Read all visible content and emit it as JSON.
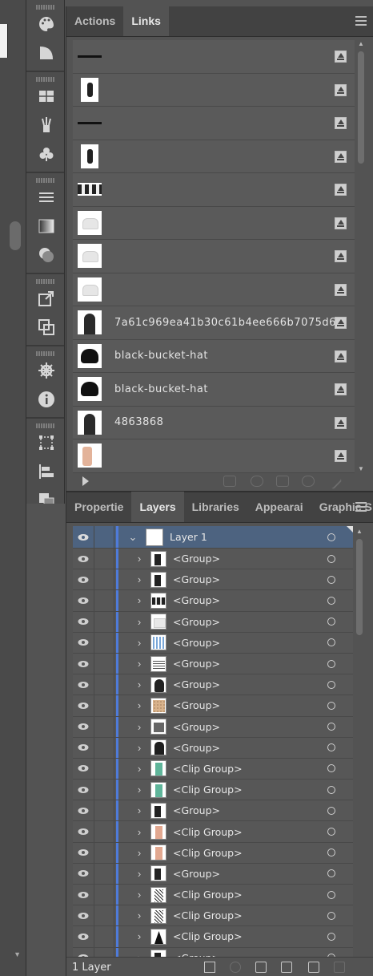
{
  "tools": [
    [
      "palette-icon",
      "gradient-swatch-icon"
    ],
    [
      "swatches-icon",
      "brush-icon",
      "club-icon"
    ],
    [
      "stroke-icon",
      "gradient-icon",
      "transparency-icon"
    ],
    [
      "export-icon",
      "artboards-icon"
    ],
    [
      "helm-icon",
      "info-icon"
    ],
    [
      "transform-icon",
      "align-icon",
      "pathfinder-icon"
    ]
  ],
  "links_panel": {
    "tabs": [
      {
        "label": "Actions",
        "active": false
      },
      {
        "label": "Links",
        "active": true
      }
    ],
    "rows": [
      {
        "thumb": "strip",
        "name": ""
      },
      {
        "thumb": "tall",
        "name": ""
      },
      {
        "thumb": "strip",
        "name": ""
      },
      {
        "thumb": "tall",
        "name": ""
      },
      {
        "thumb": "faces",
        "name": ""
      },
      {
        "thumb": "light",
        "name": ""
      },
      {
        "thumb": "light",
        "name": ""
      },
      {
        "thumb": "light",
        "name": ""
      },
      {
        "thumb": "person",
        "name": "7a61c969ea41b30c61b4ee666b7075d6"
      },
      {
        "thumb": "black",
        "name": "black-bucket-hat"
      },
      {
        "thumb": "black",
        "name": "black-bucket-hat"
      },
      {
        "thumb": "person",
        "name": "4863868"
      },
      {
        "thumb": "pink",
        "name": ""
      }
    ]
  },
  "layers_panel": {
    "tabs": [
      {
        "label": "Propertie",
        "active": false
      },
      {
        "label": "Layers",
        "active": true
      },
      {
        "label": "Libraries",
        "active": false
      },
      {
        "label": "Appearai",
        "active": false
      },
      {
        "label": "Graphic S",
        "active": false
      }
    ],
    "top_layer": {
      "name": "Layer 1"
    },
    "rows": [
      {
        "name": "<Group>",
        "thumb": "t-group"
      },
      {
        "name": "<Group>",
        "thumb": "t-group"
      },
      {
        "name": "<Group>",
        "thumb": "t-faces"
      },
      {
        "name": "<Group>",
        "thumb": "t-light"
      },
      {
        "name": "<Group>",
        "thumb": "t-blue"
      },
      {
        "name": "<Group>",
        "thumb": "t-grid"
      },
      {
        "name": "<Group>",
        "thumb": "t-head"
      },
      {
        "name": "<Group>",
        "thumb": "t-leopard"
      },
      {
        "name": "<Group>",
        "thumb": "t-gray"
      },
      {
        "name": "<Group>",
        "thumb": "t-dark"
      },
      {
        "name": "<Clip Group>",
        "thumb": "t-green"
      },
      {
        "name": "<Clip Group>",
        "thumb": "t-green"
      },
      {
        "name": "<Group>",
        "thumb": "t-group"
      },
      {
        "name": "<Clip Group>",
        "thumb": "t-pink"
      },
      {
        "name": "<Clip Group>",
        "thumb": "t-pink"
      },
      {
        "name": "<Group>",
        "thumb": "t-group"
      },
      {
        "name": "<Clip Group>",
        "thumb": "t-pattern"
      },
      {
        "name": "<Clip Group>",
        "thumb": "t-pattern"
      },
      {
        "name": "<Clip Group>",
        "thumb": "t-black"
      },
      {
        "name": "<Group>",
        "thumb": "t-group"
      }
    ],
    "footer": {
      "count_label": "1 Layer"
    }
  }
}
